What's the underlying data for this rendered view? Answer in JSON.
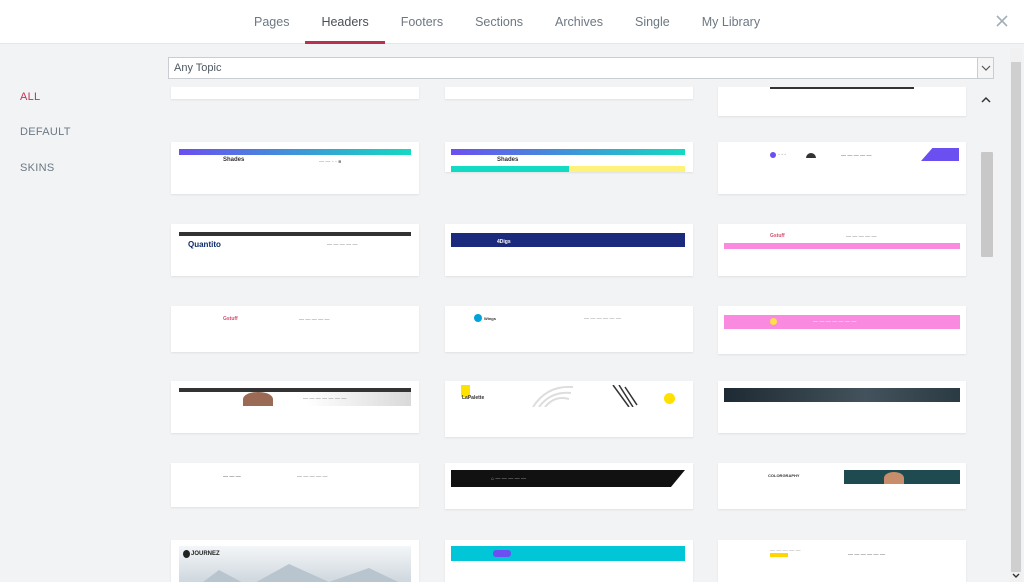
{
  "tabs": [
    {
      "label": "Pages"
    },
    {
      "label": "Headers"
    },
    {
      "label": "Footers"
    },
    {
      "label": "Sections"
    },
    {
      "label": "Archives"
    },
    {
      "label": "Single"
    },
    {
      "label": "My Library"
    }
  ],
  "active_tab": "Headers",
  "sidebar": {
    "items": [
      {
        "label": "ALL"
      },
      {
        "label": "DEFAULT"
      },
      {
        "label": "SKINS"
      }
    ]
  },
  "filter": {
    "selected": "Any Topic"
  },
  "cards": {
    "quantito": {
      "logo": "Quantito"
    },
    "digs": {
      "logo": "4Digs"
    },
    "gstuff1": {
      "logo": "Gstuff"
    },
    "gstuff2": {
      "logo": "Gstuff"
    },
    "lapalette": {
      "logo": "LaPalette"
    },
    "journez": {
      "logo": "JOURNEZ"
    },
    "shades1": {
      "logo": "Shades"
    },
    "shades2": {
      "logo": "Shades"
    },
    "colorgraphy": {
      "logo": "COLORGRAPHY"
    },
    "wings": {
      "logo": "Wings"
    }
  },
  "colors": {
    "accent": "#b5334f",
    "teal": "#13dac2",
    "purple": "#6b4ff0",
    "pink": "#f98ae0",
    "navy": "#1b2a7c",
    "cyan": "#00c6d8",
    "yellow": "#fff27a"
  }
}
